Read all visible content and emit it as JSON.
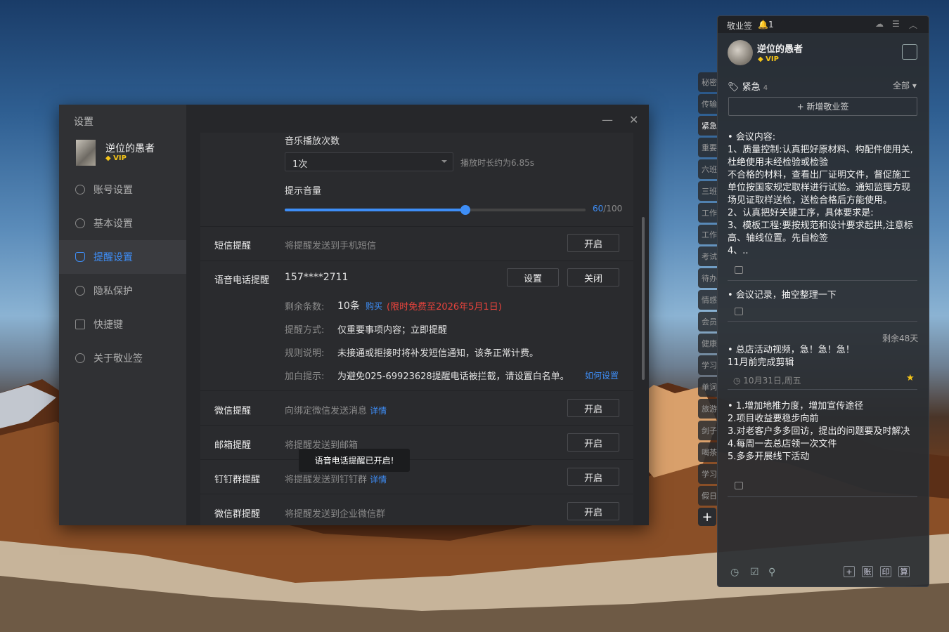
{
  "settings": {
    "title": "设置",
    "user": {
      "name": "逆位的愚者",
      "vip": "VIP"
    },
    "nav": [
      "账号设置",
      "基本设置",
      "提醒设置",
      "隐私保护",
      "快捷键",
      "关于敬业签"
    ],
    "active_nav": "提醒设置",
    "music": {
      "label": "音乐播放次数",
      "selected": "1次",
      "duration": "播放时长约为6.85s"
    },
    "volume": {
      "label": "提示音量",
      "value": 60,
      "display": "60",
      "max_display": "/100"
    },
    "sms": {
      "label": "短信提醒",
      "desc": "将提醒发送到手机短信",
      "button": "开启"
    },
    "voice": {
      "label": "语音电话提醒",
      "phone": "157****2711",
      "btn_settings": "设置",
      "btn_close": "关闭",
      "remain_label": "剩余条数:",
      "remain_value": "10条",
      "buy": "购买",
      "free_note": "(限时免费至2026年5月1日)",
      "mode_label": "提醒方式:",
      "mode_value": "仅重要事项内容；立即提醒",
      "rule_label": "规则说明:",
      "rule_value": "未接通或拒接时将补发短信通知，该条正常计费。",
      "white_label": "加白提示:",
      "white_value": "为避免025-69923628提醒电话被拦截，请设置白名单。",
      "white_link": "如何设置"
    },
    "wechat": {
      "label": "微信提醒",
      "desc": "向绑定微信发送消息",
      "link": "详情",
      "button": "开启"
    },
    "email": {
      "label": "邮箱提醒",
      "desc": "将提醒发送到邮箱",
      "button": "开启"
    },
    "dingtalk": {
      "label": "钉钉群提醒",
      "desc": "将提醒发送到钉钉群",
      "link": "详情",
      "button": "开启"
    },
    "wecom": {
      "label": "微信群提醒",
      "desc": "将提醒发送到企业微信群",
      "button": "开启"
    },
    "toast": "语音电话提醒已开启!"
  },
  "sticky": {
    "app": "敬业签",
    "notif_count": "1",
    "user": {
      "name": "逆位的愚者",
      "vip": "VIP"
    },
    "category": "紧急",
    "category_count": "4",
    "filter": "全部",
    "add_button": "+ 新增敬业签",
    "notes": [
      {
        "lines": [
          "• 会议内容:",
          "1、质量控制:认真把好原材料、构配件使用关,杜绝使用未经检验或检验",
          "不合格的材料，查看出厂证明文件，督促施工单位按国家规定取样进行试验。通知监理方现场见证取样送检，送检合格后方能使用。",
          "2、认真把好关键工序，具体要求是:",
          "3、模板工程:要按规范和设计要求起拱,注意标高、轴线位置。先自检签",
          "4、.."
        ]
      },
      {
        "lines": [
          "• 会议记录，抽空整理一下"
        ]
      },
      {
        "remaining": "剩余48天",
        "lines": [
          "• 总店活动视频，急！急！急！",
          "11月前完成剪辑"
        ],
        "date": "10月31日,周五"
      },
      {
        "lines": [
          "• 1.增加地推力度，增加宣传途径",
          "2.项目收益要稳步向前",
          "3.对老客户多多回访，提出的问题要及时解决",
          "4.每周一去总店领一次文件",
          "5.多多开展线下活动"
        ]
      }
    ],
    "side_tabs": [
      "秘密",
      "传输",
      "紧急",
      "重要",
      "六班",
      "三班",
      "工作",
      "工作",
      "考试",
      "待办",
      "情感",
      "会员",
      "健康",
      "学习",
      "单词",
      "旅游",
      "剑子",
      "喝茶",
      "学习",
      "假日"
    ],
    "active_tab": "紧急",
    "footer_boxes": [
      "+",
      "账",
      "印",
      "算"
    ]
  }
}
